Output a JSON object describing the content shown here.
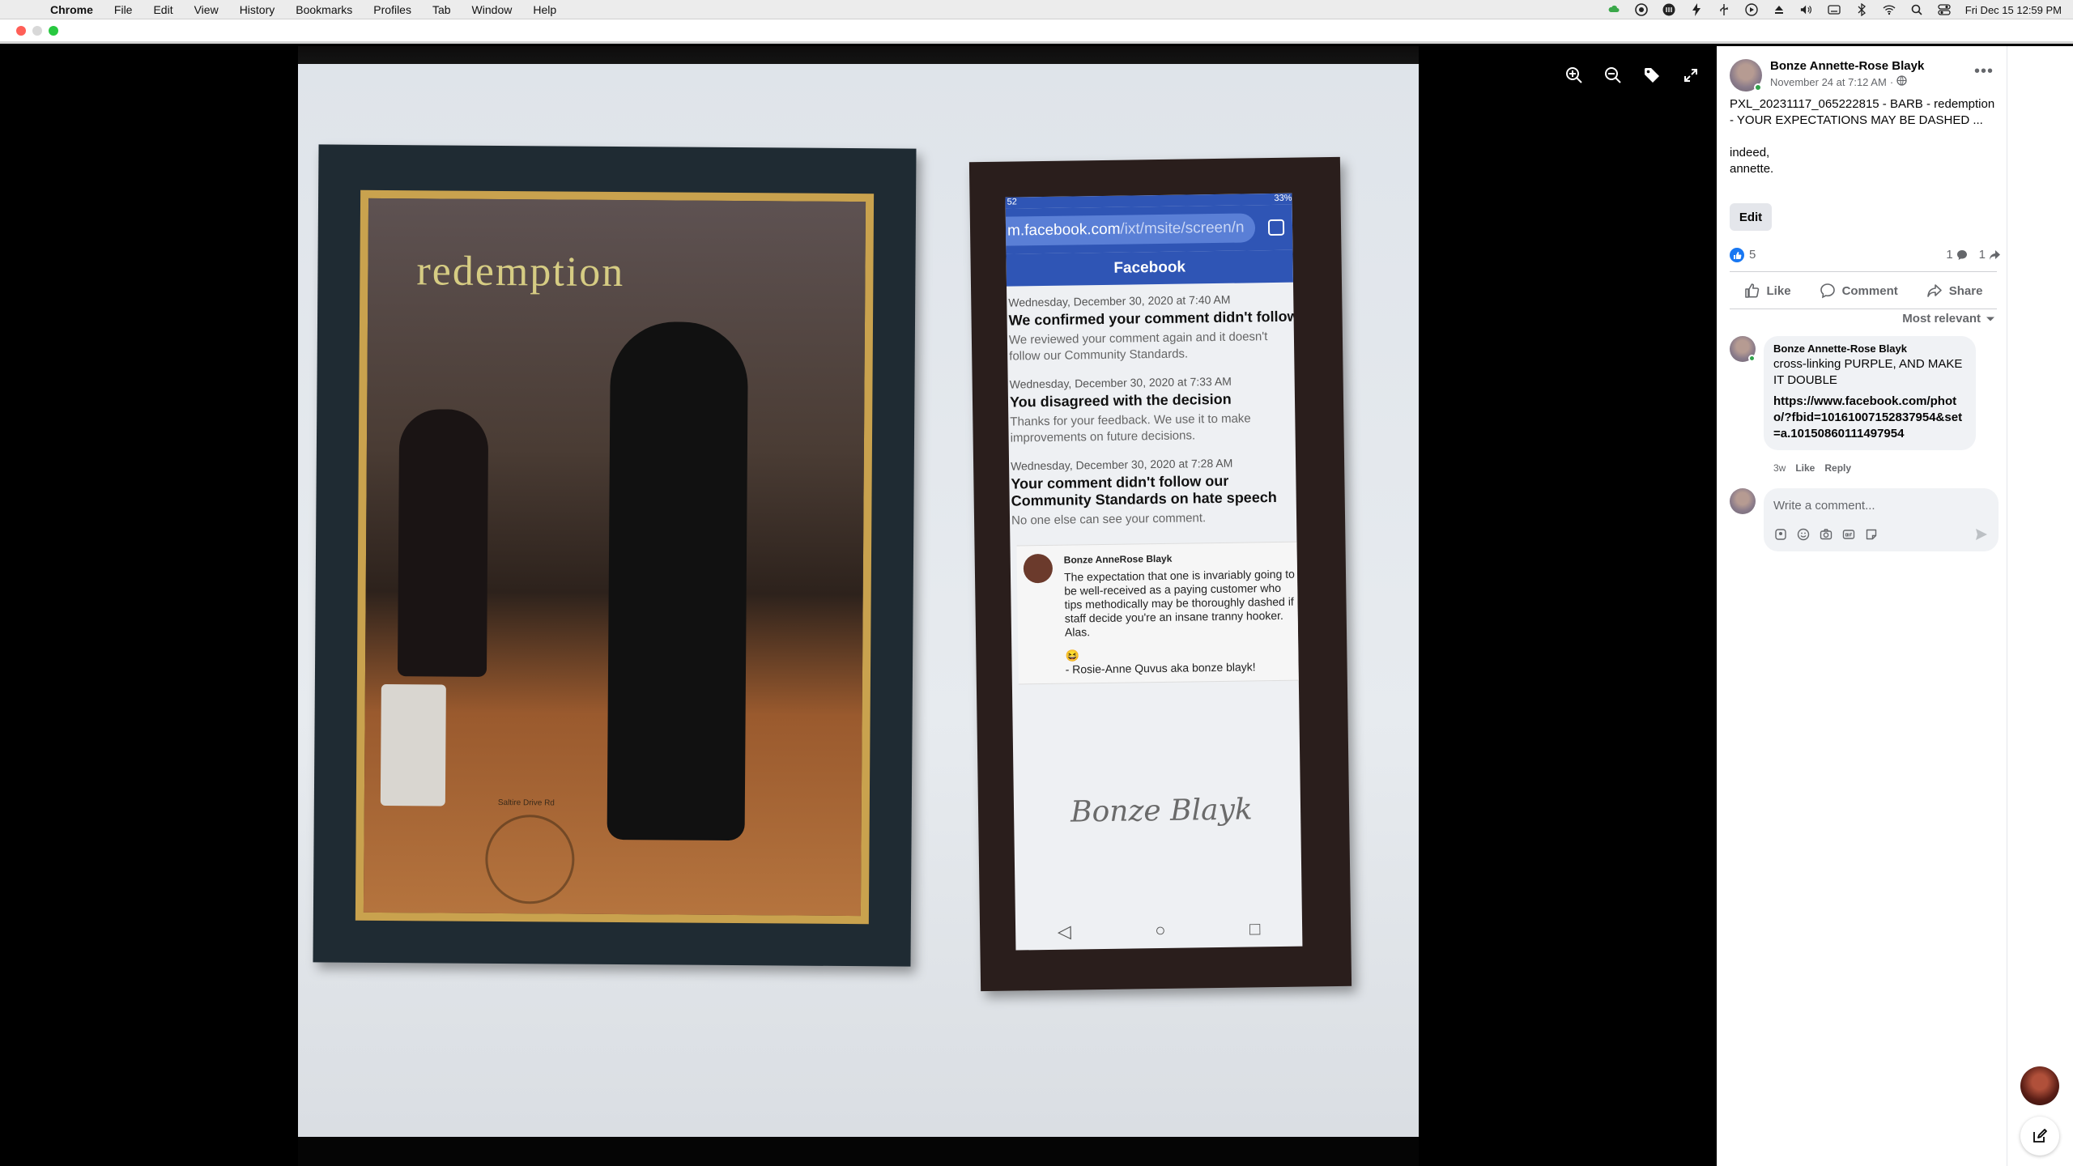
{
  "menubar": {
    "app": "Chrome",
    "items": [
      "File",
      "Edit",
      "View",
      "History",
      "Bookmarks",
      "Profiles",
      "Tab",
      "Window",
      "Help"
    ],
    "clock": "Fri Dec 15  12:59 PM"
  },
  "photo": {
    "art_title": "redemption",
    "art_stamp": "Saltire Drive Rd",
    "phone": {
      "status_left": "52",
      "status_right": "33%",
      "url_main": "m.facebook.com",
      "url_rest": "/ixt/msite/screen/n",
      "fb_title": "Facebook",
      "notices": [
        {
          "date": "Wednesday, December 30, 2020 at 7:40 AM",
          "head": "We confirmed your comment didn't follow the Community Standards",
          "body": "We reviewed your comment again and it doesn't follow our Community Standards."
        },
        {
          "date": "Wednesday, December 30, 2020 at 7:33 AM",
          "head": "You disagreed with the decision",
          "body": "Thanks for your feedback. We use it to make improvements on future decisions."
        },
        {
          "date": "Wednesday, December 30, 2020 at 7:28 AM",
          "head": "Your comment didn't follow our Community Standards on hate speech",
          "body": "No one else can see your comment."
        }
      ],
      "embedded": {
        "name": "Bonze AnneRose Blayk",
        "text": "The expectation that one is invariably going to be well-received as a paying customer who tips methodically may be thoroughly dashed if staff decide you're an insane tranny hooker. Alas.",
        "emoji": "😆",
        "sign": "- Rosie-Anne Quvus aka bonze blayk!"
      },
      "signature": "Bonze Blayk"
    }
  },
  "post": {
    "author": "Bonze Annette-Rose Blayk",
    "time": "November 24 at 7:12 AM",
    "time_sep": "·",
    "text_line1": "PXL_20231117_065222815 - BARB - redemption - YOUR EXPECTATIONS MAY BE DASHED ...",
    "text_line2": "indeed,",
    "text_line3": "annette.",
    "edit_label": "Edit",
    "reaction_count": "5",
    "comment_count": "1",
    "share_count": "1",
    "actions": {
      "like": "Like",
      "comment": "Comment",
      "share": "Share"
    },
    "sort_label": "Most relevant"
  },
  "comment": {
    "author": "Bonze Annette-Rose Blayk",
    "text": "cross-linking PURPLE, AND MAKE IT DOUBLE",
    "link": "https://www.facebook.com/photo/?fbid=10161007152837954&set=a.10150860111497954",
    "age": "3w",
    "like": "Like",
    "reply": "Reply"
  },
  "composer": {
    "placeholder": "Write a comment..."
  },
  "colors": {
    "facebook_blue": "#1877f2",
    "phone_bar_blue": "#2f55b5",
    "online_green": "#31a24c"
  }
}
